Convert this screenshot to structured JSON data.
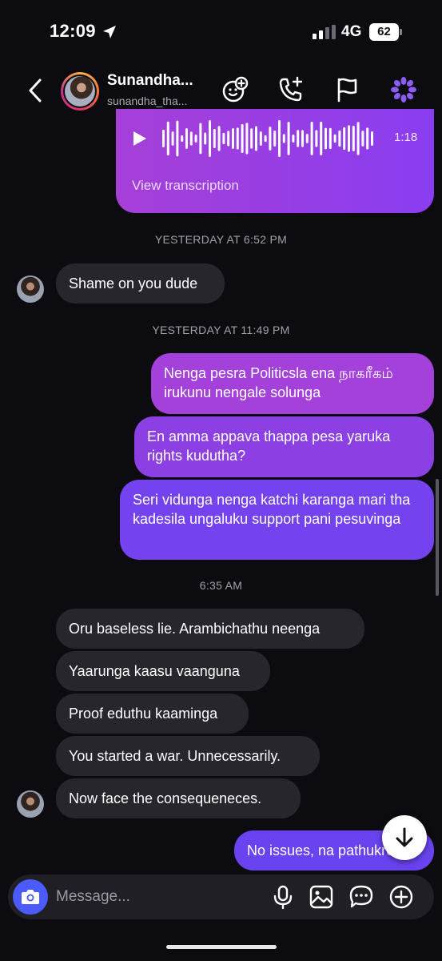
{
  "status_bar": {
    "time": "12:09",
    "network": "4G",
    "battery": "62"
  },
  "header": {
    "name": "Sunandha...",
    "username": "sunandha_tha..."
  },
  "voice_message": {
    "duration": "1:18",
    "transcription_label": "View transcription"
  },
  "messages": [
    {
      "type": "timestamp",
      "text": "YESTERDAY AT 6:52 PM"
    },
    {
      "type": "received",
      "text": "Shame on you dude"
    },
    {
      "type": "timestamp",
      "text": "YESTERDAY AT 11:49 PM"
    },
    {
      "type": "sent",
      "text": "Nenga pesra Politicsla ena நாகரீகம் irukunu nengale solunga"
    },
    {
      "type": "sent",
      "text": "En amma appava thappa pesa yaruka rights kudutha?"
    },
    {
      "type": "sent",
      "text": "Seri vidunga nenga katchi karanga mari tha kadesila ungaluku support pani pesuvinga"
    },
    {
      "type": "timestamp",
      "text": "6:35 AM"
    },
    {
      "type": "received",
      "text": "Oru baseless lie. Arambichathu neenga"
    },
    {
      "type": "received",
      "text": "Yaarunga kaasu vaanguna"
    },
    {
      "type": "received",
      "text": "Proof eduthu kaaminga"
    },
    {
      "type": "received",
      "text": "You started a war. Unnecessarily."
    },
    {
      "type": "received",
      "text": "Now face the consequeneces."
    },
    {
      "type": "sent",
      "text": "No issues, na pathukren"
    }
  ],
  "composer": {
    "placeholder": "Message..."
  },
  "colors": {
    "sent_gradient_top": "#a83fd9",
    "sent_gradient_bottom": "#6a42f2",
    "received_bg": "#26262c",
    "camera_button": "#4c5bff"
  }
}
